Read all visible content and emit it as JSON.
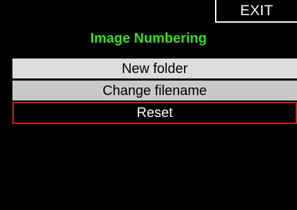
{
  "header": {
    "exit_label": "EXIT"
  },
  "screen": {
    "title": "Image Numbering"
  },
  "menu": {
    "items": [
      {
        "label": "New folder",
        "selected": false
      },
      {
        "label": "Change filename",
        "selected": false
      },
      {
        "label": "Reset",
        "selected": true
      }
    ]
  },
  "colors": {
    "background": "#000000",
    "title": "#3ddc1e",
    "item_bg_1": "#dcdcdc",
    "item_bg_2": "#c8c8c8",
    "selection_border": "#d42020",
    "text_light": "#ffffff",
    "text_dark": "#000000"
  }
}
